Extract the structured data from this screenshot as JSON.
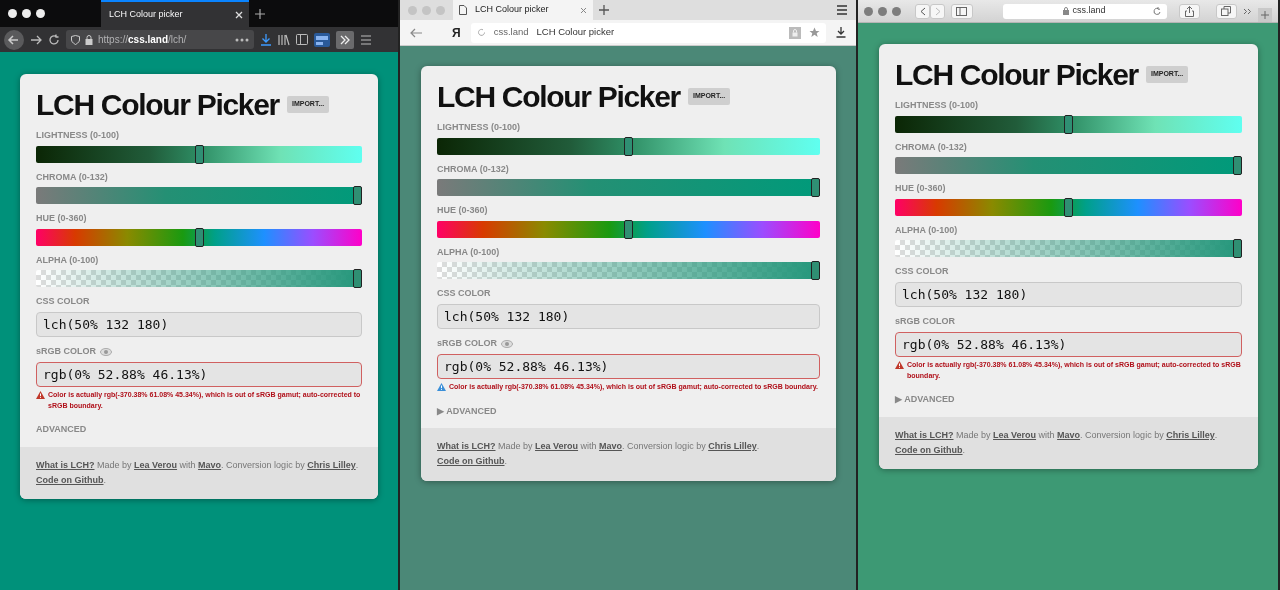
{
  "windows": [
    {
      "kind": "firefox",
      "color": "#00917a",
      "tab": {
        "title": "LCH Colour picker",
        "selected": true
      },
      "url": "https://**css.land**/lch/",
      "app": {
        "title": "LCH Colour Picker",
        "import_button": "IMPORT...",
        "sliders": [
          {
            "kind": "lightness",
            "label": "LIGHTNESS (0-100)",
            "level": 0.5
          },
          {
            "kind": "chroma",
            "label": "CHROMA (0-132)",
            "level": 1
          },
          {
            "kind": "hue",
            "label": "HUE (0-360)",
            "level": 0.5
          },
          {
            "kind": "alpha",
            "label": "ALPHA (0-100)",
            "level": 1
          }
        ],
        "css_color": {
          "label": "CSS COLOR",
          "value": "lch(50% 132 180)"
        },
        "srgb_color": {
          "label": "sRGB COLOR",
          "eye_icon": true,
          "value": "rgb(0% 52.88% 46.13%)",
          "warning": {
            "color": "#c0392b",
            "text": "Color is actually rgb(-370.38% 61.08% 45.34%), which is out of sRGB gamut; auto-corrected to sRGB boundary."
          }
        },
        "advanced": {
          "label": "ADVANCED"
        },
        "footer": [
          {
            "text": "What is LCH?",
            "link": true
          },
          {
            "text": " Made by ",
            "link": false
          },
          {
            "text": "Lea Verou",
            "link": true
          },
          {
            "text": " with ",
            "link": false
          },
          {
            "text": "Mavo",
            "link": true
          },
          {
            "text": ". Conversion logic by ",
            "link": false
          },
          {
            "text": "Chris Lilley",
            "link": true
          },
          {
            "text": ". ",
            "link": false
          },
          {
            "text": "Code on Github",
            "link": true
          },
          {
            "text": ".",
            "link": false
          }
        ]
      }
    },
    {
      "kind": "yandex",
      "color": "#4b8877",
      "tab": {
        "title": "LCH Colour picker",
        "selected": true
      },
      "logo": "Я",
      "url": "css.land",
      "page_title": "LCH Colour picker",
      "app": {
        "title": "LCH Colour Picker",
        "import_button": "IMPORT...",
        "sliders": [
          {
            "kind": "lightness",
            "label": "LIGHTNESS (0-100)",
            "level": 0.5
          },
          {
            "kind": "chroma",
            "label": "CHROMA (0-132)",
            "level": 1
          },
          {
            "kind": "hue",
            "label": "HUE (0-360)",
            "level": 0.5
          },
          {
            "kind": "alpha",
            "label": "ALPHA (0-100)",
            "level": 1
          }
        ],
        "css_color": {
          "label": "CSS COLOR",
          "value": "lch(50% 132 180)"
        },
        "srgb_color": {
          "label": "sRGB COLOR",
          "eye_icon": true,
          "value": "rgb(0% 52.88% 46.13%)",
          "warning": {
            "color": "#3a8fd8",
            "text": "Color is actually rgb(-370.38% 61.08% 45.34%), which is out of sRGB gamut; auto-corrected to sRGB boundary."
          }
        },
        "advanced": {
          "marker": "▶",
          "label": "ADVANCED"
        },
        "footer": [
          {
            "text": "What is LCH?",
            "link": true
          },
          {
            "text": " Made by ",
            "link": false
          },
          {
            "text": "Lea Verou",
            "link": true
          },
          {
            "text": " with ",
            "link": false
          },
          {
            "text": "Mavo",
            "link": true
          },
          {
            "text": ". Conversion logic by ",
            "link": false
          },
          {
            "text": "Chris Lilley",
            "link": true
          },
          {
            "text": ". ",
            "link": false
          },
          {
            "text": "Code on Github",
            "link": true
          },
          {
            "text": ".",
            "link": false
          }
        ]
      }
    },
    {
      "kind": "safari",
      "color": "#3d9974",
      "url": "css.land",
      "app": {
        "title": "LCH Colour Picker",
        "import_button": "IMPORT...",
        "sliders": [
          {
            "kind": "lightness",
            "label": "LIGHTNESS (0-100)",
            "level": 0.5
          },
          {
            "kind": "chroma",
            "label": "CHROMA (0-132)",
            "level": 1
          },
          {
            "kind": "hue",
            "label": "HUE (0-360)",
            "level": 0.5
          },
          {
            "kind": "alpha",
            "label": "ALPHA (0-100)",
            "level": 1
          }
        ],
        "css_color": {
          "label": "CSS COLOR",
          "value": "lch(50% 132 180)"
        },
        "srgb_color": {
          "label": "sRGB COLOR",
          "eye_icon": false,
          "value": "rgb(0% 52.88% 46.13%)",
          "warning": {
            "color": "#c0392b",
            "text": "Color is actually rgb(-370.38% 61.08% 45.34%), which is out of sRGB gamut; auto-corrected to sRGB boundary."
          }
        },
        "advanced": {
          "marker": "▶",
          "label": "ADVANCED"
        },
        "footer": [
          {
            "text": "What is LCH?",
            "link": true
          },
          {
            "text": " Made by ",
            "link": false
          },
          {
            "text": "Lea Verou",
            "link": true
          },
          {
            "text": " with ",
            "link": false
          },
          {
            "text": "Mavo",
            "link": true
          },
          {
            "text": ". Conversion logic by ",
            "link": false
          },
          {
            "text": "Chris Lilley",
            "link": true
          },
          {
            "text": ". ",
            "link": false
          },
          {
            "text": "Code on Github",
            "link": true
          },
          {
            "text": ".",
            "link": false
          }
        ]
      }
    }
  ]
}
